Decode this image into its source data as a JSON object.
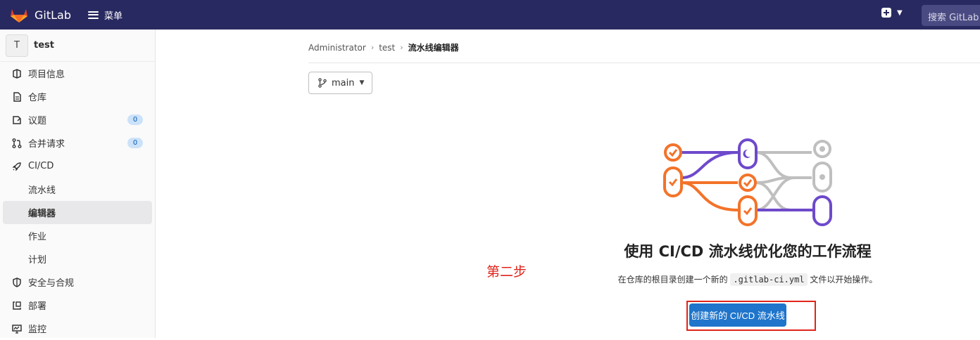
{
  "header": {
    "brand": "GitLab",
    "menu_label": "菜单",
    "search_placeholder": "搜索 GitLab",
    "colors": {
      "bar": "#292961",
      "logo_orange": "#e24329"
    }
  },
  "sidebar": {
    "project_avatar": "T",
    "project_name": "test",
    "items": [
      {
        "label": "项目信息",
        "icon": "project-info-icon"
      },
      {
        "label": "仓库",
        "icon": "document-icon"
      },
      {
        "label": "议题",
        "icon": "issues-icon",
        "badge": "0"
      },
      {
        "label": "合并请求",
        "icon": "merge-request-icon",
        "badge": "0"
      },
      {
        "label": "CI/CD",
        "icon": "rocket-icon"
      }
    ],
    "cicd_sub": [
      "流水线",
      "编辑器",
      "作业",
      "计划"
    ],
    "active_sub": "编辑器",
    "items_after": [
      {
        "label": "安全与合规",
        "icon": "shield-icon"
      },
      {
        "label": "部署",
        "icon": "deploy-icon"
      },
      {
        "label": "监控",
        "icon": "monitor-icon"
      }
    ]
  },
  "breadcrumb": [
    "Administrator",
    "test",
    "流水线编辑器"
  ],
  "branch": {
    "label": "main"
  },
  "empty_state": {
    "title": "使用 CI/CD 流水线优化您的工作流程",
    "desc_before": "在仓库的根目录创建一个新的",
    "desc_code": ".gitlab-ci.yml",
    "desc_after": "文件以开始操作。",
    "cta_label": "创建新的 CI/CD 流水线"
  },
  "annotation": {
    "text": "第二步",
    "color": "#e0241b"
  },
  "colors": {
    "primary": "#1f75cb",
    "badge_bg": "#cbe2f9",
    "pipeline_orange": "#f37329",
    "pipeline_purple": "#6e49cb",
    "pipeline_grey": "#bfbfbf"
  }
}
